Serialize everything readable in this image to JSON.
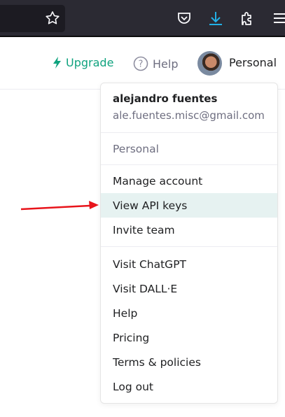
{
  "browser": {
    "icons": [
      "star-icon",
      "pocket-icon",
      "download-icon",
      "extensions-icon",
      "menu-icon"
    ],
    "download_color": "#22b0e6"
  },
  "header": {
    "upgrade": "Upgrade",
    "help": "Help",
    "account": "Personal",
    "accent": "#10a37f"
  },
  "menu": {
    "user_name": "alejandro fuentes",
    "email": "ale.fuentes.misc@gmail.com",
    "org": "Personal",
    "group1": [
      "Manage account",
      "View API keys",
      "Invite team"
    ],
    "group2": [
      "Visit ChatGPT",
      "Visit DALL·E",
      "Help",
      "Pricing",
      "Terms & policies",
      "Log out"
    ],
    "highlighted": "View API keys"
  },
  "annotation": {
    "arrow_color": "#e8141b"
  }
}
